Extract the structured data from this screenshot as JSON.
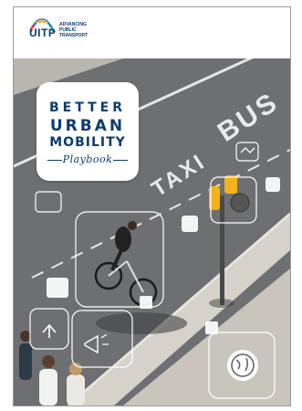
{
  "logo": {
    "name": "UITP",
    "tagline": [
      "ADVANCING",
      "PUBLIC",
      "TRANSPORT"
    ],
    "ring_colors": [
      "#e8452c",
      "#f6a81c",
      "#2aa8a1",
      "#0c6fb5"
    ]
  },
  "title": {
    "line1": "BETTER",
    "line2": "URBAN",
    "line3": "MOBILITY",
    "line4": "Playbook"
  },
  "road_text": {
    "bus": "BUS",
    "taxi": "TAXI"
  },
  "colors": {
    "brand_blue": "#0c3b6e",
    "road": "#6d6f72",
    "sidewalk": "#c9c5bd"
  },
  "icons": [
    "handshake-icon",
    "megaphone-icon",
    "upload-arrow-icon",
    "globe-icon"
  ]
}
